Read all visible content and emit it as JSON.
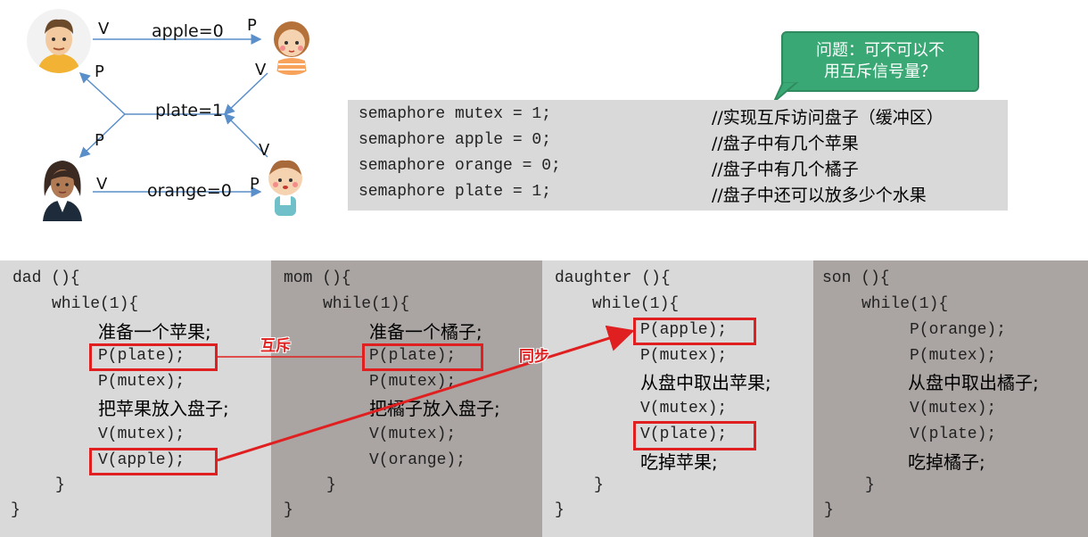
{
  "diagram": {
    "apple_edge": "apple=0",
    "plate_edge": "plate=1",
    "orange_edge": "orange=0",
    "v": "V",
    "p": "P"
  },
  "bubble": {
    "line1": "问题：可不可以不",
    "line2": "用互斥信号量？"
  },
  "semaphores": [
    {
      "code": "semaphore mutex = 1;",
      "comment": "//实现互斥访问盘子（缓冲区）"
    },
    {
      "code": "semaphore apple = 0;",
      "comment": "//盘子中有几个苹果"
    },
    {
      "code": "semaphore orange = 0;",
      "comment": "//盘子中有几个橘子"
    },
    {
      "code": "semaphore plate = 1;",
      "comment": "//盘子中还可以放多少个水果"
    }
  ],
  "processes": {
    "dad": {
      "header": "dad (){",
      "while": "while(1){",
      "l1": "准备一个苹果;",
      "l2": "P(plate);",
      "l3": "P(mutex);",
      "l4": "把苹果放入盘子;",
      "l5": "V(mutex);",
      "l6": "V(apple);",
      "close_inner": "}",
      "close_outer": "}"
    },
    "mom": {
      "header": "mom (){",
      "while": "while(1){",
      "l1": "准备一个橘子;",
      "l2": "P(plate);",
      "l3": "P(mutex);",
      "l4": "把橘子放入盘子;",
      "l5": "V(mutex);",
      "l6": "V(orange);",
      "close_inner": "}",
      "close_outer": "}"
    },
    "daughter": {
      "header": "daughter (){",
      "while": "while(1){",
      "l1": "P(apple);",
      "l2": "P(mutex);",
      "l3": "从盘中取出苹果;",
      "l4": "V(mutex);",
      "l5": "V(plate);",
      "l6": "吃掉苹果;",
      "close_inner": "}",
      "close_outer": "}"
    },
    "son": {
      "header": "son (){",
      "while": "while(1){",
      "l1": "P(orange);",
      "l2": "P(mutex);",
      "l3": "从盘中取出橘子;",
      "l4": "V(mutex);",
      "l5": "V(plate);",
      "l6": "吃掉橘子;",
      "close_inner": "}",
      "close_outer": "}"
    }
  },
  "annotations": {
    "mutual_exclusion": "互斥",
    "sync": "同步"
  },
  "colors": {
    "highlight": "#e02020",
    "bubble": "#3aa874",
    "panel_light": "#d9d9d9",
    "panel_dark": "#aaa5a3"
  }
}
